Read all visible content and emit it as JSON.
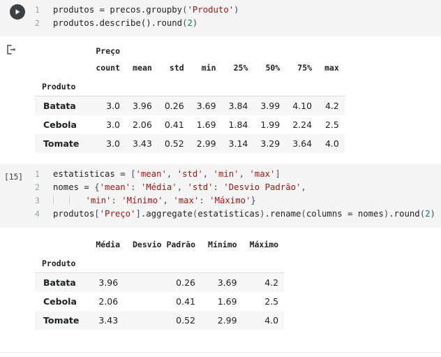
{
  "cells": [
    {
      "gutter_type": "run-button",
      "exec_label": "",
      "lines": [
        {
          "no": "1"
        },
        {
          "no": "2"
        }
      ],
      "code": {
        "l1_a": "produtos = precos.groupby(",
        "l1_paren_open": "(",
        "l1_str": "'Produto'",
        "l1_paren_close": ")",
        "l2_a": "produtos.describe().round(",
        "l2_num": "2",
        "l2_close": ")"
      }
    },
    {
      "gutter_type": "exec-count",
      "exec_label": "[15]",
      "lines": [
        {
          "no": "1"
        },
        {
          "no": "2"
        },
        {
          "no": "3"
        },
        {
          "no": "4"
        }
      ]
    }
  ],
  "cell1": {
    "run_icon": "play-icon",
    "line_numbers": [
      "1",
      "2"
    ],
    "line1": {
      "pre": "produtos = precos.groupby",
      "open": "(",
      "string": "'Produto'",
      "close": ")"
    },
    "line2": {
      "pre": "produtos.describe().round",
      "open": "(",
      "num": "2",
      "close": ")"
    }
  },
  "output1": {
    "icon": "output-arrow-icon",
    "column_group_label": "Preço",
    "index_name": "Produto",
    "columns": [
      "count",
      "mean",
      "std",
      "min",
      "25%",
      "50%",
      "75%",
      "max"
    ],
    "rows": [
      {
        "index": "Batata",
        "values": [
          "3.0",
          "3.96",
          "0.26",
          "3.69",
          "3.84",
          "3.99",
          "4.10",
          "4.2"
        ]
      },
      {
        "index": "Cebola",
        "values": [
          "3.0",
          "2.06",
          "0.41",
          "1.69",
          "1.84",
          "1.99",
          "2.24",
          "2.5"
        ]
      },
      {
        "index": "Tomate",
        "values": [
          "3.0",
          "3.43",
          "0.52",
          "2.99",
          "3.14",
          "3.29",
          "3.64",
          "4.0"
        ]
      }
    ]
  },
  "cell2": {
    "exec_label": "[15]",
    "line_numbers": [
      "1",
      "2",
      "3",
      "4"
    ],
    "line1": {
      "pre": "estatisticas = ",
      "b1": "[",
      "s1": "'mean'",
      "c1": ", ",
      "s2": "'std'",
      "c2": ", ",
      "s3": "'min'",
      "c3": ", ",
      "s4": "'max'",
      "b2": "]"
    },
    "line2": {
      "pre": "nomes = ",
      "b1": "{",
      "s1": "'mean'",
      "c1": ": ",
      "s2": "'Média'",
      "c2": ", ",
      "s3": "'std'",
      "c3": ": ",
      "s4": "'Desvio Padrão'",
      "c4": ","
    },
    "line3": {
      "s1": "'min'",
      "c1": ": ",
      "s2": "'Mínimo'",
      "c2": ", ",
      "s3": "'max'",
      "c3": ": ",
      "s4": "'Máximo'",
      "b2": "}"
    },
    "line4": {
      "a": "produtos",
      "b1": "[",
      "s1": "'Preço'",
      "b2": "]",
      "b": ".aggregate",
      "p1": "(",
      "c": "estatisticas",
      "p2": ")",
      "d": ".rename",
      "p3": "(",
      "e": "columns = nomes",
      "p4": ")",
      "f": ".round",
      "p5": "(",
      "n": "2",
      "p6": ")"
    }
  },
  "output2": {
    "index_name": "Produto",
    "columns": [
      "Média",
      "Desvio Padrão",
      "Mínimo",
      "Máximo"
    ],
    "rows": [
      {
        "index": "Batata",
        "values": [
          "3.96",
          "0.26",
          "3.69",
          "4.2"
        ]
      },
      {
        "index": "Cebola",
        "values": [
          "2.06",
          "0.41",
          "1.69",
          "2.5"
        ]
      },
      {
        "index": "Tomate",
        "values": [
          "3.43",
          "0.52",
          "2.99",
          "4.0"
        ]
      }
    ]
  },
  "colors": {
    "cell_bg": "#f5f5f5",
    "string": "#a31515",
    "number": "#098658",
    "punct": "#3b4c66",
    "text": "#202124",
    "line_number": "#9aa0a6",
    "row_stripe": "#f7f7f7",
    "divider": "#dadce0"
  }
}
